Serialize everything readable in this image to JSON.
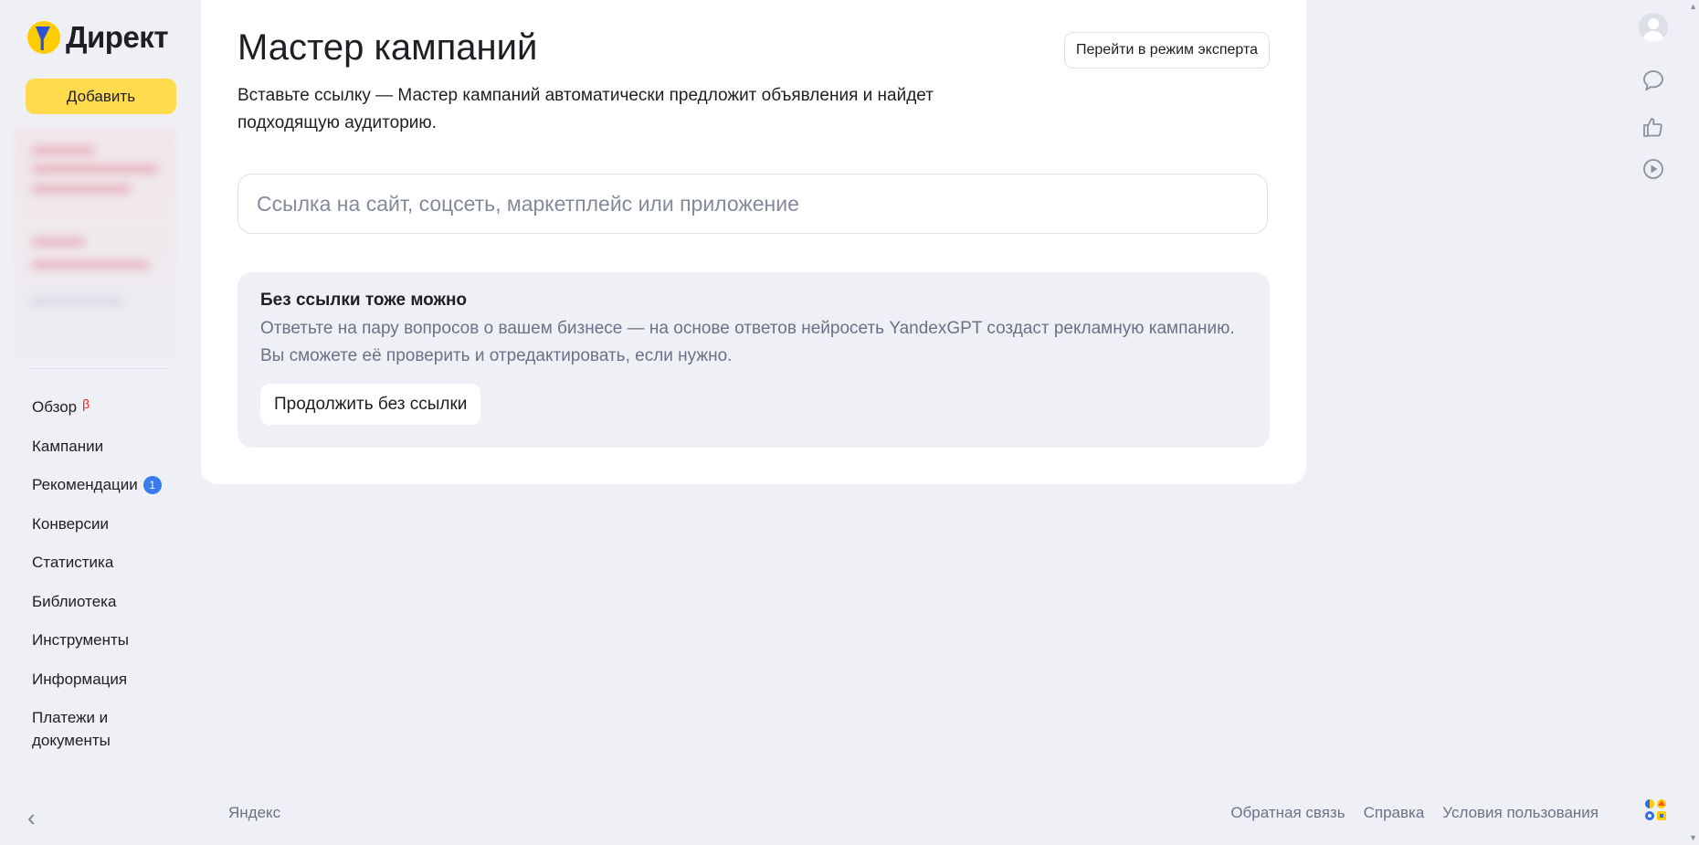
{
  "app": {
    "logo_text": "Директ",
    "add_button": "Добавить"
  },
  "sidebar": {
    "items": [
      {
        "label": "Обзор",
        "beta": "β"
      },
      {
        "label": "Кампании"
      },
      {
        "label": "Рекомендации",
        "badge": "1"
      },
      {
        "label": "Конверсии"
      },
      {
        "label": "Статистика"
      },
      {
        "label": "Библиотека"
      },
      {
        "label": "Инструменты"
      },
      {
        "label": "Информация"
      },
      {
        "label": "Платежи и документы"
      }
    ],
    "collapse_glyph": "‹"
  },
  "main": {
    "title": "Мастер кампаний",
    "expert_button": "Перейти в режим эксперта",
    "subtitle": "Вставьте ссылку — Мастер кампаний автоматически предложит объявления и найдет подходящую аудиторию.",
    "url_placeholder": "Ссылка на сайт, соцсеть, маркетплейс или приложение",
    "url_value": "",
    "no_link": {
      "title": "Без ссылки тоже можно",
      "text": "Ответьте на пару вопросов о вашем бизнесе — на основе ответов нейросеть YandexGPT создаст рекламную кампанию. Вы сможете её проверить и отредактировать, если нужно.",
      "button": "Продолжить без ссылки"
    }
  },
  "rail": {
    "icons": [
      "avatar",
      "chat-icon",
      "thumbs-up-icon",
      "play-icon",
      "apps-icon"
    ]
  },
  "footer": {
    "brand": "Яндекс",
    "links": [
      "Обратная связь",
      "Справка",
      "Условия пользования"
    ]
  },
  "colors": {
    "background": "#eef0f5",
    "accent_yellow": "#ffdb4d",
    "badge_blue": "#3a7cf0",
    "beta_red": "#e0271f",
    "muted_text": "#6b7186"
  }
}
